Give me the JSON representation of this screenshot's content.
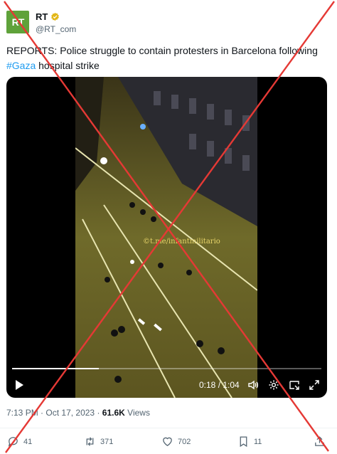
{
  "author": {
    "name": "RT",
    "handle": "@RT_com",
    "avatar_text": "RT",
    "avatar_color": "#5fa23a",
    "verified_badge_color": "#e2b719"
  },
  "tweet": {
    "text_before": "REPORTS: Police struggle to contain protesters in Barcelona following ",
    "hashtag": "#Gaza",
    "text_after": " hospital strike"
  },
  "video": {
    "watermark": "©t.me/infantmilitario",
    "time": "0:18 / 1:04",
    "progress_fraction": 0.28
  },
  "meta": {
    "time": "7:13 PM",
    "separator": "·",
    "date": "Oct 17, 2023",
    "views_count": "61.6K",
    "views_label": "Views"
  },
  "actions": {
    "replies": "41",
    "reposts": "371",
    "likes": "702",
    "bookmarks": "11"
  },
  "colors": {
    "link": "#1d9bf0",
    "overlay_x": "#e53935"
  }
}
